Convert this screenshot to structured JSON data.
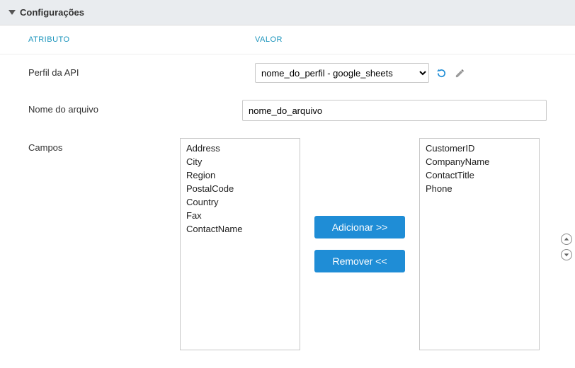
{
  "section": {
    "title": "Configurações"
  },
  "columns": {
    "attribute": "ATRIBUTO",
    "value": "VALOR"
  },
  "rows": {
    "api_profile": {
      "label": "Perfil da API",
      "selected": "nome_do_perfil - google_sheets"
    },
    "filename": {
      "label": "Nome do arquivo",
      "value": "nome_do_arquivo"
    },
    "fields": {
      "label": "Campos",
      "available": [
        "Address",
        "City",
        "Region",
        "PostalCode",
        "Country",
        "Fax",
        "ContactName"
      ],
      "selected": [
        "CustomerID",
        "CompanyName",
        "ContactTitle",
        "Phone"
      ],
      "add_label": "Adicionar >>",
      "remove_label": "Remover  <<"
    }
  }
}
